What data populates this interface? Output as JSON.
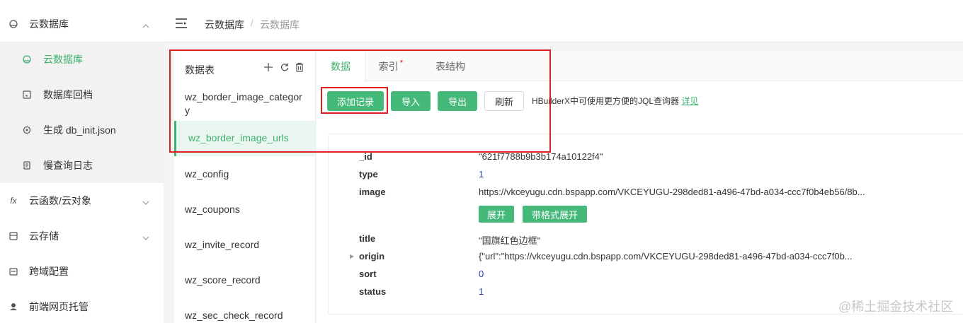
{
  "sidebar": {
    "items": [
      {
        "label": "云数据库",
        "icon": "cloud-db-icon"
      },
      {
        "label": "云数据库",
        "icon": "cloud-db-icon"
      },
      {
        "label": "数据库回档",
        "icon": "rollback-icon"
      },
      {
        "label": "生成 db_init.json",
        "icon": "generate-icon"
      },
      {
        "label": "慢查询日志",
        "icon": "log-icon"
      },
      {
        "label": "云函数/云对象",
        "icon": "fx-icon",
        "icon_text": "fx"
      },
      {
        "label": "云存储",
        "icon": "storage-icon"
      },
      {
        "label": "跨域配置",
        "icon": "cors-icon"
      },
      {
        "label": "前端网页托管",
        "icon": "hosting-icon"
      }
    ]
  },
  "header": {
    "breadcrumb": [
      "云数据库",
      "云数据库"
    ],
    "separator": "/"
  },
  "tables": {
    "title": "数据表",
    "items": [
      {
        "name": "wz_border_image_category"
      },
      {
        "name": "wz_border_image_urls"
      },
      {
        "name": "wz_config"
      },
      {
        "name": "wz_coupons"
      },
      {
        "name": "wz_invite_record"
      },
      {
        "name": "wz_score_record"
      },
      {
        "name": "wz_sec_check_record"
      }
    ],
    "category_line1": "wz_border_image_categor",
    "category_line2": "y"
  },
  "tabs": [
    {
      "label": "数据"
    },
    {
      "label": "索引",
      "star": "*"
    },
    {
      "label": "表结构"
    }
  ],
  "toolbar": {
    "add": "添加记录",
    "import": "导入",
    "export": "导出",
    "refresh": "刷新",
    "hint": "HBuilderX中可使用更方便的JQL查询器",
    "hint_link": "详见"
  },
  "record": {
    "id_key": "_id",
    "id_val": "\"621f7788b9b3b174a10122f4\"",
    "type_key": "type",
    "type_val": "1",
    "image_key": "image",
    "image_val": "https://vkceyugu.cdn.bspapp.com/VKCEYUGU-298ded81-a496-47bd-a034-ccc7f0b4eb56/8b...",
    "expand": "展开",
    "expand_formatted": "带格式展开",
    "title_key": "title",
    "title_val": "\"国旗红色边框\"",
    "origin_key": "origin",
    "origin_val": "{\"url\":\"https://vkceyugu.cdn.bspapp.com/VKCEYUGU-298ded81-a496-47bd-a034-ccc7f0b...",
    "sort_key": "sort",
    "sort_val": "0",
    "status_key": "status",
    "status_val": "1"
  },
  "watermark": "@稀土掘金技术社区",
  "colors": {
    "accent": "#45b97a",
    "highlight": "#e02020"
  }
}
